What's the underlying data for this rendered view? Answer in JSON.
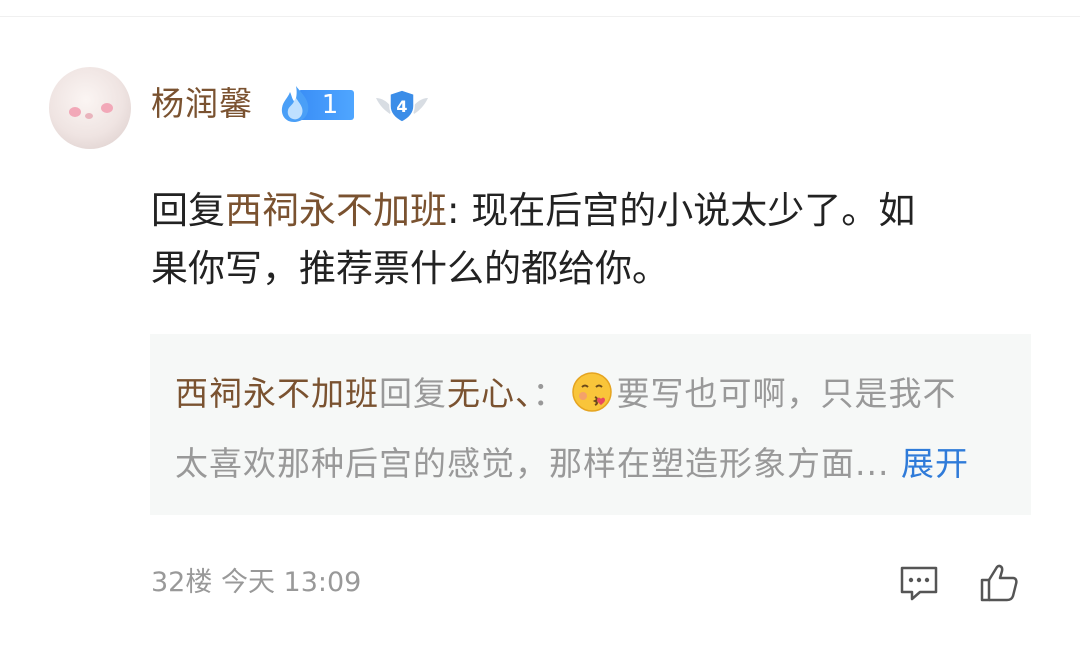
{
  "comment": {
    "username": "杨润馨",
    "level": "1",
    "badge_level": "4",
    "reply_prefix": "回复",
    "reply_target": "西祠永不加班",
    "separator": ": ",
    "text_line1": "现在后宫的小说太少了。如",
    "text_line2": "果你写，推荐票什么的都给你。"
  },
  "quote": {
    "author": "西祠永不加班",
    "reply_word": "回复",
    "target": "无心、",
    "colon": "：",
    "text_line1": "要写也可啊，只是我不",
    "text_line2": "太喜欢那种后宫的感觉，那样在塑造形象方面...",
    "expand_label": "展开"
  },
  "footer": {
    "floor_time": "32楼 今天 13:09"
  },
  "icons": {
    "reply": "comment-icon",
    "like": "thumbs-up-icon",
    "level": "flame-icon",
    "badge": "shield-badge-icon",
    "emoji": "kissing-face-icon"
  },
  "colors": {
    "username": "#7a5230",
    "level_blue": "#3a8ef6",
    "expand_link": "#2f7bd9",
    "quote_bg": "#f6f8f7",
    "meta_gray": "#999999"
  }
}
